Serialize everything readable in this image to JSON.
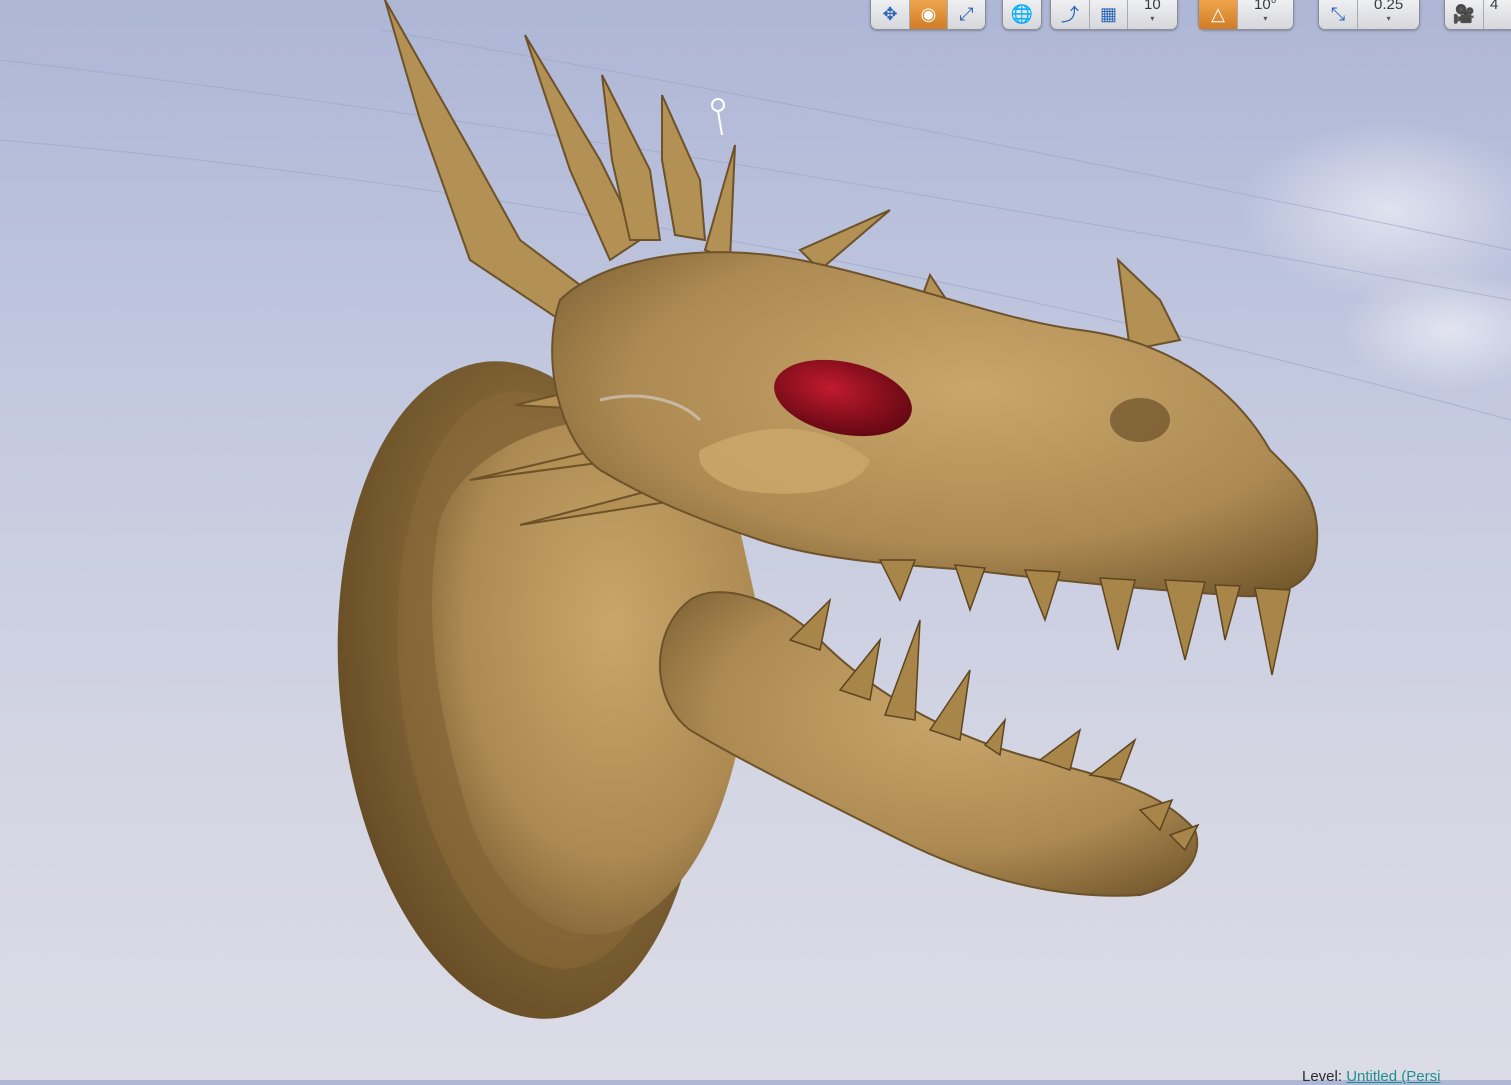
{
  "toolbar": {
    "icons": [
      "translate-icon",
      "rotate-icon",
      "scale-icon",
      "world-local-icon",
      "surface-snap-icon",
      "grid-snap-icon",
      "rotation-snap-icon",
      "scale-snap-icon",
      "camera-speed-icon"
    ],
    "grid_snap_value": "10",
    "rotation_snap_value": "10°",
    "scale_snap_value": "0.25",
    "camera_speed_value": "4"
  },
  "status_bar": {
    "level_label": "Level:",
    "level_name": "Untitled (Persi"
  },
  "colors": {
    "sky_top": "#aeb6d6",
    "sky_bottom": "#dcdce6",
    "model_base": "#b9955a",
    "eye": "#9a0f1e",
    "active_button": "#e08e32"
  }
}
